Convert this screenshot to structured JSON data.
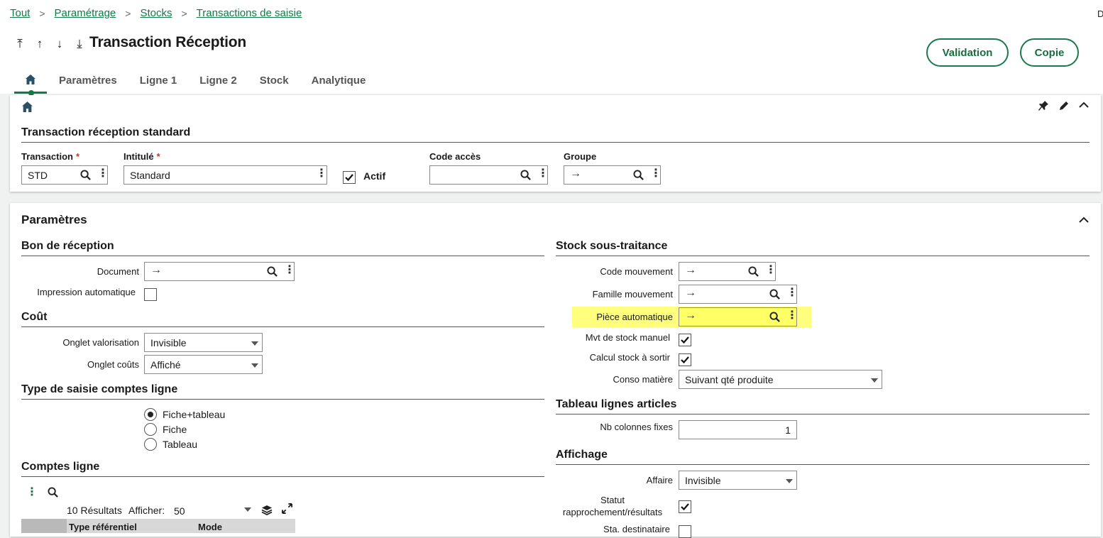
{
  "breadcrumb": [
    "Tout",
    "Paramétrage",
    "Stocks",
    "Transactions de saisie"
  ],
  "corner_letter": "D",
  "page_title": "Transaction Réception",
  "buttons": {
    "validation": "Validation",
    "copie": "Copie"
  },
  "tabs": [
    "Paramètres",
    "Ligne 1",
    "Ligne 2",
    "Stock",
    "Analytique"
  ],
  "header_card": {
    "title": "Transaction réception standard",
    "transaction": {
      "label": "Transaction",
      "value": "STD"
    },
    "intitule": {
      "label": "Intitulé",
      "value": "Standard"
    },
    "actif": {
      "label": "Actif",
      "checked": true
    },
    "code_acces": {
      "label": "Code accès",
      "value": ""
    },
    "groupe": {
      "label": "Groupe",
      "value": ""
    },
    "required_mark": "*"
  },
  "parametres": {
    "title": "Paramètres",
    "bon_reception": {
      "title": "Bon de réception",
      "document_label": "Document",
      "impression_label": "Impression automatique"
    },
    "cout": {
      "title": "Coût",
      "onglet_valorisation": {
        "label": "Onglet valorisation",
        "value": "Invisible"
      },
      "onglet_couts": {
        "label": "Onglet coûts",
        "value": "Affiché"
      }
    },
    "type_saisie": {
      "title": "Type de saisie comptes ligne",
      "options": [
        "Fiche+tableau",
        "Fiche",
        "Tableau"
      ],
      "selected": "Fiche+tableau"
    },
    "comptes_ligne": {
      "title": "Comptes ligne",
      "results": "10 Résultats",
      "afficher_label": "Afficher:",
      "afficher_value": "50",
      "columns": [
        "Type référentiel",
        "Mode"
      ]
    },
    "stock_sous_traitance": {
      "title": "Stock sous-traitance",
      "code_mouvement": "Code mouvement",
      "famille_mouvement": "Famille mouvement",
      "piece_automatique": "Pièce automatique",
      "mvt_stock_manuel": {
        "label": "Mvt de stock manuel",
        "checked": true
      },
      "calcul_stock": {
        "label": "Calcul stock à sortir",
        "checked": true
      },
      "conso_matiere": {
        "label": "Conso matière",
        "value": "Suivant qté produite"
      }
    },
    "tableau_lignes": {
      "title": "Tableau lignes articles",
      "nb_colonnes": {
        "label": "Nb colonnes fixes",
        "value": "1"
      }
    },
    "affichage": {
      "title": "Affichage",
      "affaire": {
        "label": "Affaire",
        "value": "Invisible"
      },
      "statut_line1": "Statut",
      "statut_line2": "rapprochement/résultats",
      "sta_destinataire": "Sta. destinataire"
    }
  },
  "colors": {
    "accent": "#117a47",
    "highlight": "#ffff66"
  }
}
